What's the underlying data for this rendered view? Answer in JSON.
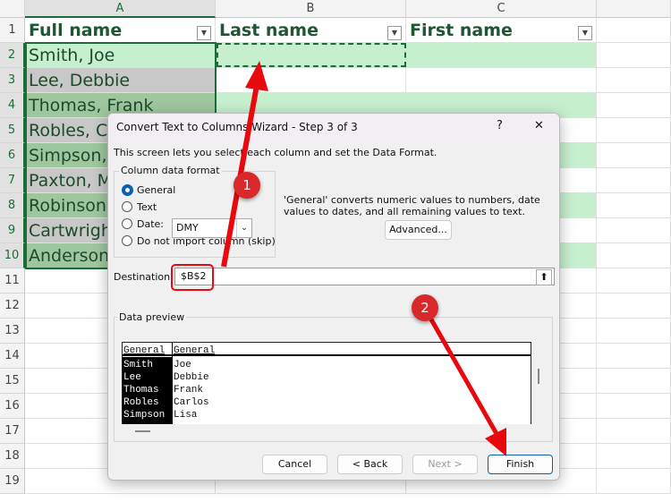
{
  "sheet": {
    "columns": [
      "A",
      "B",
      "C"
    ],
    "rows": [
      "1",
      "2",
      "3",
      "4",
      "5",
      "6",
      "7",
      "8",
      "9",
      "10",
      "11",
      "12",
      "13",
      "14",
      "15",
      "16",
      "17",
      "18",
      "19"
    ],
    "headers": [
      "Full name",
      "Last name",
      "First name"
    ],
    "full_names": [
      "Smith, Joe",
      "Lee, Debbie",
      "Thomas, Frank",
      "Robles, Carlos",
      "Simpson, Lisa",
      "Paxton, M",
      "Robinson",
      "Cartwright",
      "Anderson"
    ]
  },
  "dialog": {
    "title": "Convert Text to Columns Wizard - Step 3 of 3",
    "help": "?",
    "close": "✕",
    "intro": "This screen lets you select each column and set the Data Format.",
    "group_label": "Column data format",
    "options": [
      "General",
      "Text",
      "Date:",
      "Do not import column (skip)"
    ],
    "selected_option": "General",
    "date_value": "DMY",
    "description": "'General' converts numeric values to numbers, date values to dates, and all remaining values to text.",
    "advanced": "Advanced...",
    "destination_label": "Destination:",
    "destination_value": "$B$2",
    "preview_label": "Data preview",
    "preview_headers": [
      "General",
      "General"
    ],
    "preview_rows": [
      [
        "Smith",
        "Joe"
      ],
      [
        "Lee",
        "Debbie"
      ],
      [
        "Thomas",
        "Frank"
      ],
      [
        "Robles",
        "Carlos"
      ],
      [
        "Simpson",
        "Lisa"
      ]
    ],
    "buttons": {
      "cancel": "Cancel",
      "back": "< Back",
      "next": "Next >",
      "finish": "Finish"
    }
  },
  "annotations": {
    "step1": "1",
    "step2": "2",
    "color": "#e8090f"
  }
}
